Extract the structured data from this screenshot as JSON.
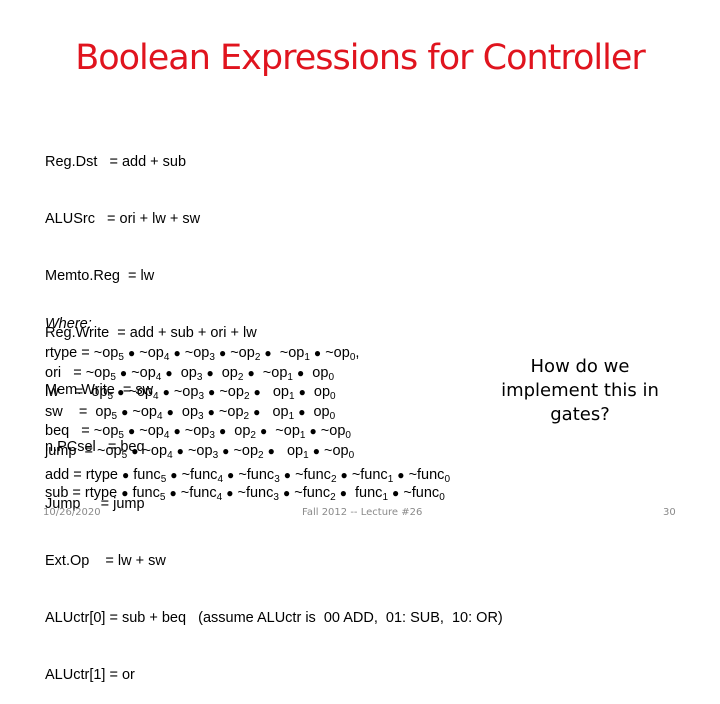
{
  "slide": {
    "title": "Boolean Expressions for Controller",
    "signals": [
      "Reg.Dst   = add + sub",
      "ALUSrc   = ori + lw + sw",
      "Memto.Reg  = lw",
      "Reg.Write  = add + sub + ori + lw",
      "Mem.Write  = sw",
      "n.PCsel   = beq",
      "Jump     = jump",
      "Ext.Op    = lw + sw",
      "ALUctr[0] = sub + beq   (assume ALUctr is  00 ADD,  01: SUB,  10: OR)",
      "ALUctr[1] = or"
    ],
    "where_label": "Where:",
    "decode": [
      {
        "name": "rtype",
        "eq": " = ",
        "terms": [
          [
            "~op",
            "5"
          ],
          [
            "~op",
            "4"
          ],
          [
            "~op",
            "3"
          ],
          [
            "~op",
            "2"
          ],
          [
            " ~op",
            "1"
          ],
          [
            "~op",
            "0"
          ]
        ],
        "suffix": ","
      },
      {
        "name": "ori  ",
        "eq": " = ",
        "terms": [
          [
            "~op",
            "5"
          ],
          [
            "~op",
            "4"
          ],
          [
            " op",
            "3"
          ],
          [
            " op",
            "2"
          ],
          [
            " ~op",
            "1"
          ],
          [
            " op",
            "0"
          ]
        ],
        "suffix": ""
      },
      {
        "name": "lw   ",
        "eq": " =  ",
        "terms": [
          [
            "op",
            "5"
          ],
          [
            "~op",
            "4"
          ],
          [
            "~op",
            "3"
          ],
          [
            "~op",
            "2"
          ],
          [
            "  op",
            "1"
          ],
          [
            " op",
            "0"
          ]
        ],
        "suffix": ""
      },
      {
        "name": "sw   ",
        "eq": " =  ",
        "terms": [
          [
            "op",
            "5"
          ],
          [
            "~op",
            "4"
          ],
          [
            " op",
            "3"
          ],
          [
            "~op",
            "2"
          ],
          [
            "  op",
            "1"
          ],
          [
            " op",
            "0"
          ]
        ],
        "suffix": ""
      },
      {
        "name": "beq  ",
        "eq": " = ",
        "terms": [
          [
            "~op",
            "5"
          ],
          [
            "~op",
            "4"
          ],
          [
            "~op",
            "3"
          ],
          [
            " op",
            "2"
          ],
          [
            " ~op",
            "1"
          ],
          [
            "~op",
            "0"
          ]
        ],
        "suffix": ""
      },
      {
        "name": "jump ",
        "eq": " = ",
        "terms": [
          [
            "~op",
            "5"
          ],
          [
            "~op",
            "4"
          ],
          [
            "~op",
            "3"
          ],
          [
            "~op",
            "2"
          ],
          [
            "  op",
            "1"
          ],
          [
            "~op",
            "0"
          ]
        ],
        "suffix": ""
      }
    ],
    "funcs": [
      {
        "name": "add",
        "eq": " = ",
        "lead": "rtype",
        "terms": [
          [
            " func",
            "5"
          ],
          [
            "~func",
            "4"
          ],
          [
            "~func",
            "3"
          ],
          [
            "~func",
            "2"
          ],
          [
            "~func",
            "1"
          ],
          [
            "~func",
            "0"
          ]
        ]
      },
      {
        "name": "sub",
        "eq": " = ",
        "lead": "rtype",
        "terms": [
          [
            " func",
            "5"
          ],
          [
            "~func",
            "4"
          ],
          [
            "~func",
            "3"
          ],
          [
            "~func",
            "2"
          ],
          [
            " func",
            "1"
          ],
          [
            "~func",
            "0"
          ]
        ]
      }
    ],
    "callout": "How do we implement this in gates?",
    "footer": {
      "date": "10/26/2020",
      "course": "Fall 2012 -- Lecture #26",
      "page": "30"
    },
    "colors": {
      "title": "#e0141e",
      "footer": "#8a8a8a"
    }
  }
}
